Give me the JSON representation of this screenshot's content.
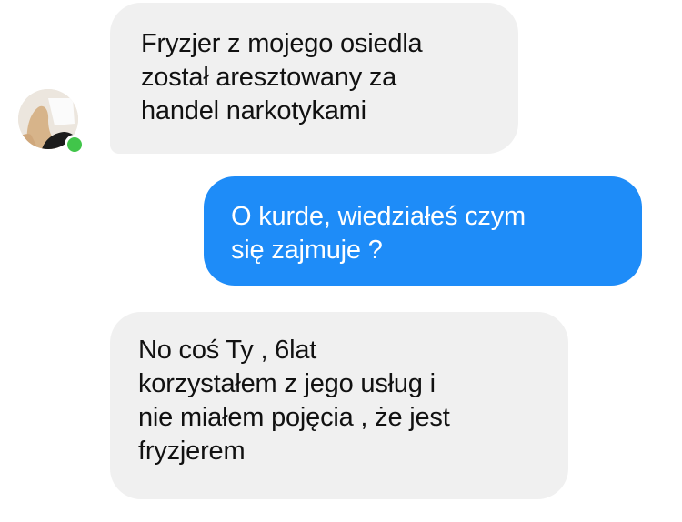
{
  "conversation": {
    "messages": [
      {
        "direction": "incoming",
        "lines": [
          "Fryzjer z mojego osiedla",
          "został aresztowany za",
          "handel narkotykami"
        ]
      },
      {
        "direction": "outgoing",
        "lines": [
          "O kurde, wiedziałeś czym",
          "się zajmuje ?"
        ]
      },
      {
        "direction": "incoming",
        "lines": [
          "No coś Ty , 6lat",
          "korzystałem z jego usług i",
          "nie miałem pojęcia , że jest",
          "fryzjerem"
        ]
      }
    ],
    "contact": {
      "online": true,
      "avatar_icon": "user-avatar",
      "presence_icon": "online-dot-icon"
    }
  },
  "colors": {
    "incoming_bubble": "#f0f0f0",
    "outgoing_bubble": "#1e8cf8",
    "incoming_text": "#111111",
    "outgoing_text": "#ffffff",
    "online": "#41c54a"
  }
}
